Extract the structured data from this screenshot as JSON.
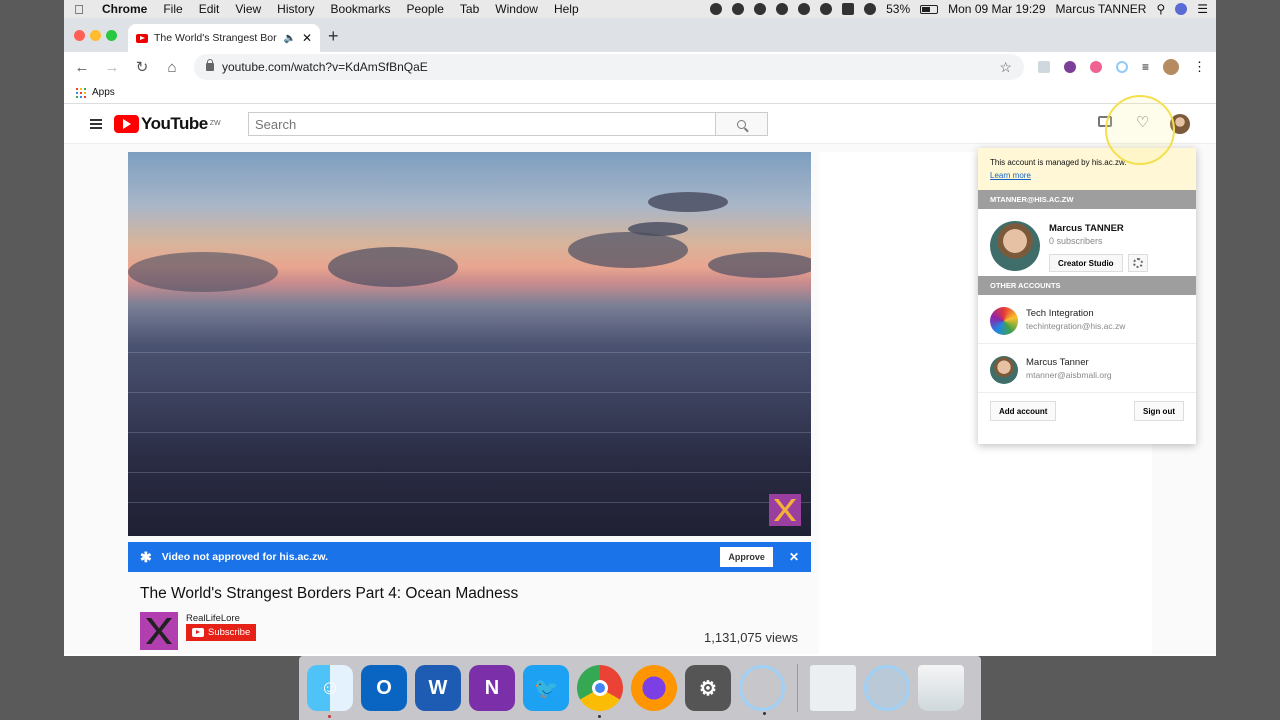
{
  "menubar": {
    "app": "Chrome",
    "items": [
      "File",
      "Edit",
      "View",
      "History",
      "Bookmarks",
      "People",
      "Tab",
      "Window",
      "Help"
    ],
    "battery": "53%",
    "datetime": "Mon 09 Mar 19:29",
    "user": "Marcus TANNER"
  },
  "browser": {
    "tab_title": "The World's Strangest Borde",
    "url": "youtube.com/watch?v=KdAmSfBnQaE",
    "bookmarks_apps": "Apps"
  },
  "youtube": {
    "logo_text": "YouTube",
    "country_code": "ZW",
    "search_placeholder": "Search",
    "banner_text": "Video not approved for his.ac.zw.",
    "approve_label": "Approve",
    "video_title": "The World's Strangest Borders Part 4: Ocean Madness",
    "channel_name": "RealLifeLore",
    "subscribe_label": "Subscribe",
    "views": "1,131,075 views"
  },
  "account_menu": {
    "managed_text": "This account is managed by his.ac.zw.",
    "learn_more": "Learn more",
    "current_header": "MTANNER@HIS.AC.ZW",
    "current_name": "Marcus TANNER",
    "current_subs": "0 subscribers",
    "creator_studio": "Creator Studio",
    "other_header": "OTHER ACCOUNTS",
    "others": [
      {
        "name": "Tech Integration",
        "email": "techintegration@his.ac.zw"
      },
      {
        "name": "Marcus Tanner",
        "email": "mtanner@aisbmali.org"
      }
    ],
    "add_account": "Add account",
    "sign_out": "Sign out"
  },
  "colors": {
    "youtube_red": "#ff0000",
    "banner_blue": "#1a73e8",
    "managed_bg": "#fff7d6",
    "header_grey": "#9e9e9e"
  }
}
